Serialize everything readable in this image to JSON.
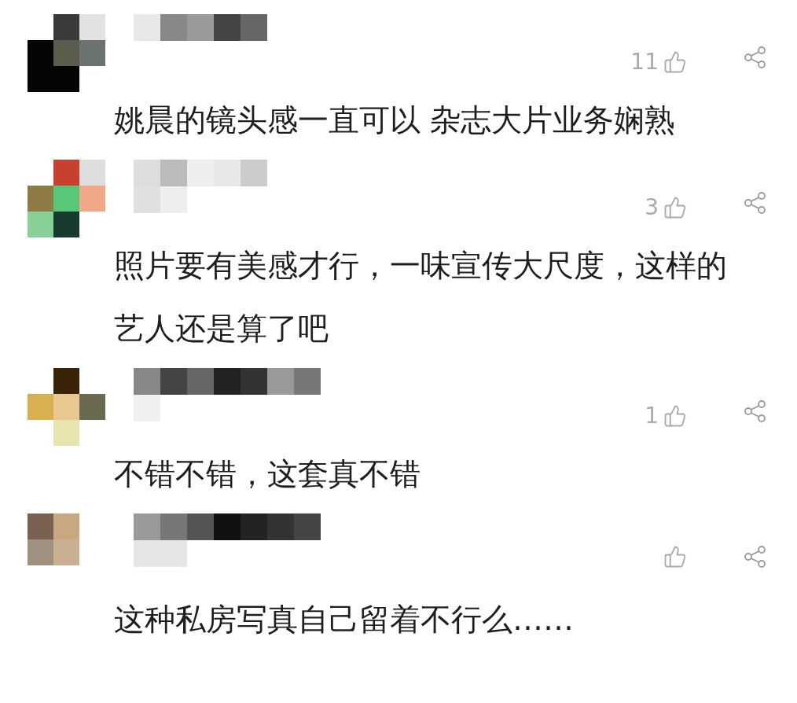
{
  "comments": [
    {
      "likes": "11",
      "text": "姚晨的镜头感一直可以 杂志大片业务娴熟"
    },
    {
      "likes": "3",
      "text": "照片要有美感才行，一味宣传大尺度，这样的艺人还是算了吧"
    },
    {
      "likes": "1",
      "text": "不错不错，这套真不错"
    },
    {
      "text": "这种私房写真自己留着不行么……"
    }
  ]
}
